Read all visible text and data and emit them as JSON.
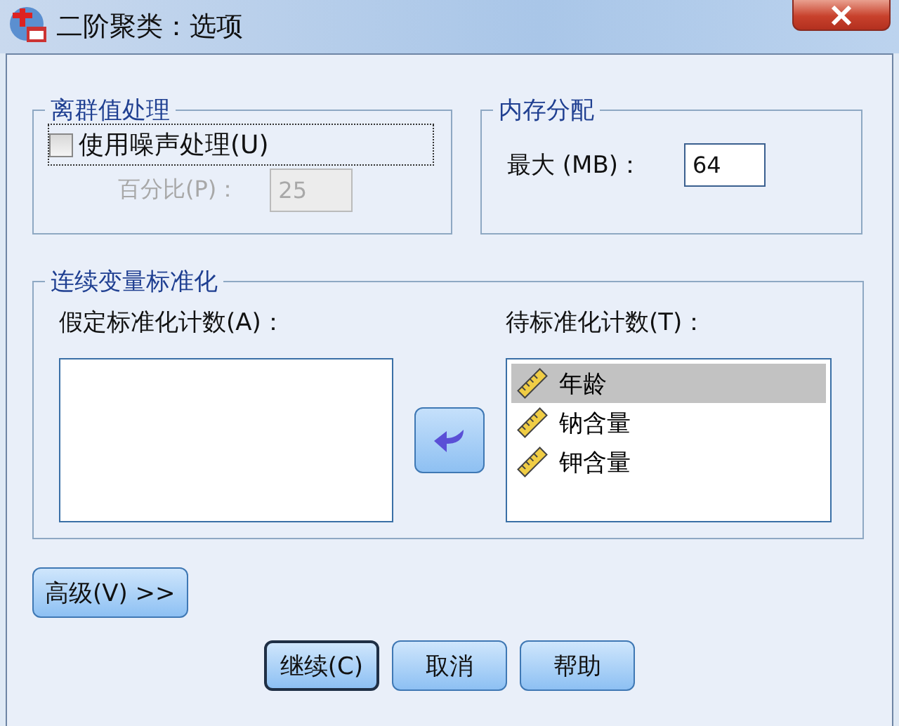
{
  "window": {
    "title": "二阶聚类：选项"
  },
  "outlier_group": {
    "title": "离群值处理",
    "noise_checkbox": {
      "label": "使用噪声处理(U)",
      "checked": false
    },
    "percent": {
      "label": "百分比(P)：",
      "value": "25",
      "disabled": true
    }
  },
  "memory_group": {
    "title": "内存分配",
    "max": {
      "label": "最大 (MB)：",
      "value": "64"
    }
  },
  "standardize_group": {
    "title": "连续变量标准化",
    "assumed_label": "假定标准化计数(A)：",
    "to_standardize": {
      "label": "待标准化计数(T)：",
      "items": [
        {
          "name": "年龄",
          "selected": true
        },
        {
          "name": "钠含量",
          "selected": false
        },
        {
          "name": "钾含量",
          "selected": false
        }
      ]
    }
  },
  "advanced_button": "高级(V) >>",
  "buttons": [
    {
      "label": "继续(C)",
      "default": true
    },
    {
      "label": "取消",
      "default": false
    },
    {
      "label": "帮助",
      "default": false
    }
  ]
}
